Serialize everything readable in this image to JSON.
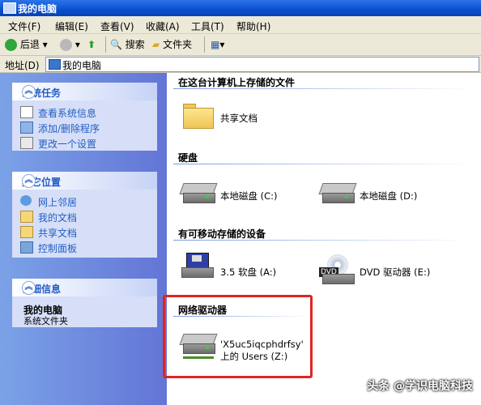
{
  "window": {
    "title": "我的电脑"
  },
  "menu": [
    "文件(F)",
    "编辑(E)",
    "查看(V)",
    "收藏(A)",
    "工具(T)",
    "帮助(H)"
  ],
  "toolbar": {
    "back": "后退",
    "search": "搜索",
    "folders": "文件夹"
  },
  "address": {
    "label": "地址(D)",
    "value": "我的电脑"
  },
  "sidebar": {
    "tasks": {
      "title": "系统任务",
      "items": [
        "查看系统信息",
        "添加/删除程序",
        "更改一个设置"
      ]
    },
    "places": {
      "title": "其它位置",
      "items": [
        "网上邻居",
        "我的文档",
        "共享文档",
        "控制面板"
      ]
    },
    "details": {
      "title": "详细信息",
      "name": "我的电脑",
      "type": "系统文件夹"
    }
  },
  "main": {
    "sections": {
      "stored": "在这台计算机上存储的文件",
      "hdd": "硬盘",
      "removable": "有可移动存储的设备",
      "network": "网络驱动器"
    },
    "items": {
      "shared_docs": "共享文档",
      "local_c": "本地磁盘 (C:)",
      "local_d": "本地磁盘 (D:)",
      "floppy": "3.5 软盘 (A:)",
      "dvd": "DVD 驱动器 (E:)",
      "dvd_badge": "DVD",
      "net_line1": "'X5uc5iqcphdrfsy'",
      "net_line2": "上的 Users (Z:)"
    }
  },
  "watermark": "头条 @学识电脑科技"
}
